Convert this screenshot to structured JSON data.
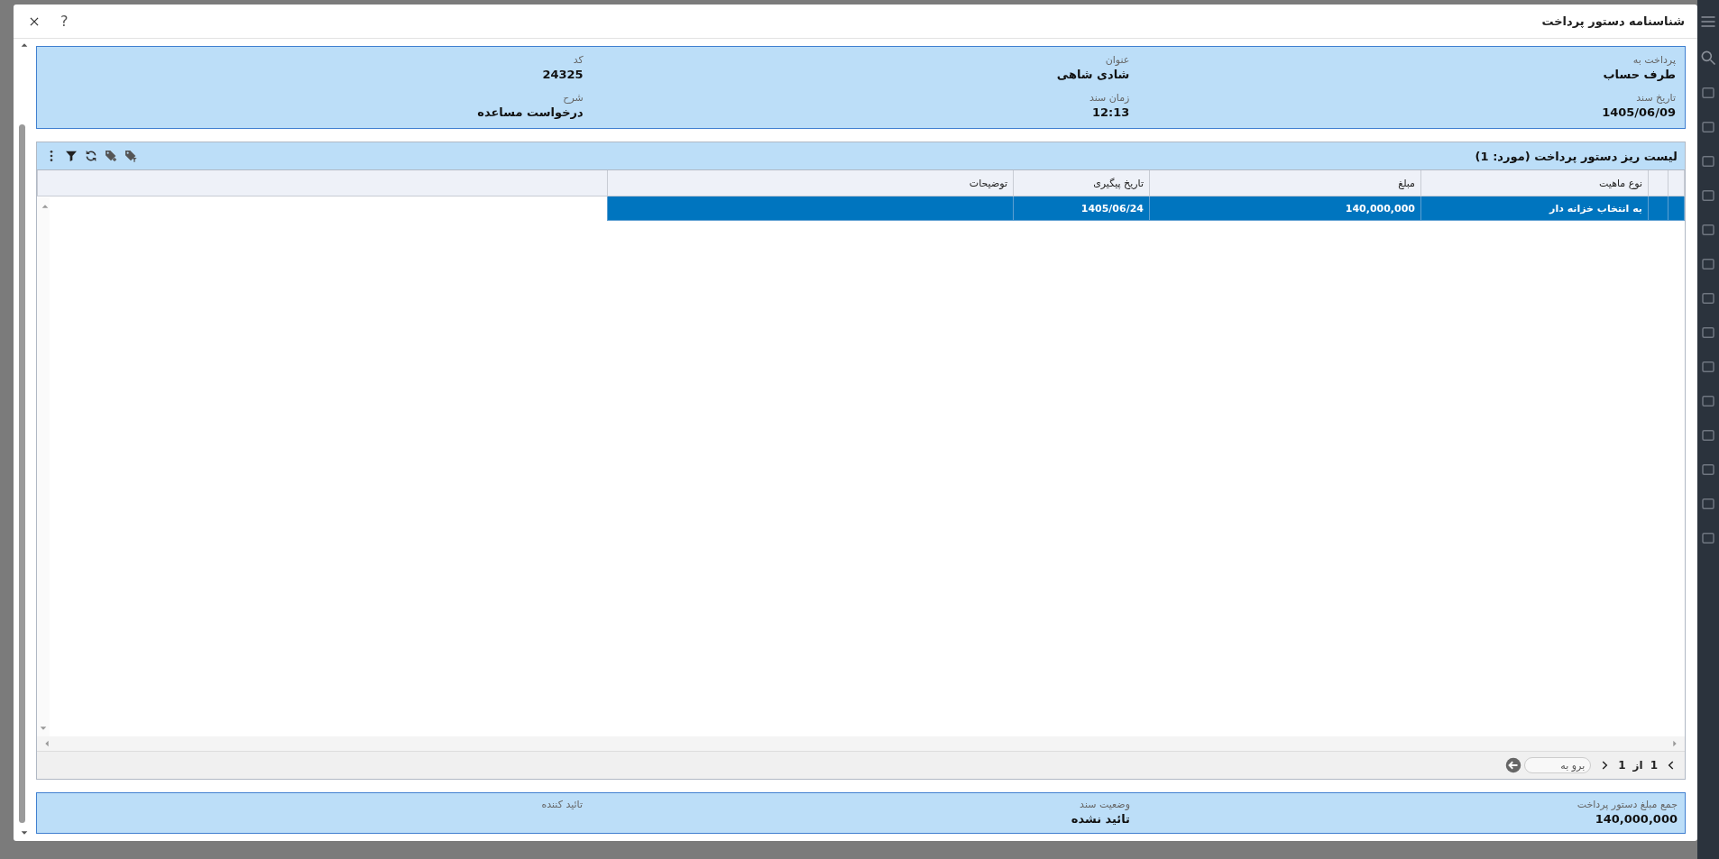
{
  "dialog": {
    "title": "شناسنامه دستور پرداخت",
    "help": "?"
  },
  "header_fields": [
    {
      "label": "پرداخت به",
      "value": "طرف حساب"
    },
    {
      "label": "عنوان",
      "value": "شادی شاهی"
    },
    {
      "label": "کد",
      "value": "24325"
    },
    {
      "label": "تاریخ سند",
      "value": "1405/06/09"
    },
    {
      "label": "زمان سند",
      "value": "12:13"
    },
    {
      "label": "شرح",
      "value": "درخواست مساعده"
    }
  ],
  "grid": {
    "title": "لیست ریز دستور پرداخت (مورد: 1)",
    "columns": [
      "نوع ماهیت",
      "مبلغ",
      "تاریخ پیگیری",
      "توضیحات"
    ],
    "rows": [
      {
        "type": "به انتخاب خزانه دار",
        "amount": "140,000,000",
        "follow_up_date": "1405/06/24",
        "selected": true
      }
    ]
  },
  "pager": {
    "current": "1",
    "of_label": "از",
    "total": "1",
    "goto_placeholder": "برو به"
  },
  "footer_fields": [
    {
      "label": "جمع مبلغ دستور پرداخت",
      "value": "140,000,000"
    },
    {
      "label": "وضعیت سند",
      "value": "تائید نشده"
    },
    {
      "label": "تائید کننده"
    }
  ]
}
